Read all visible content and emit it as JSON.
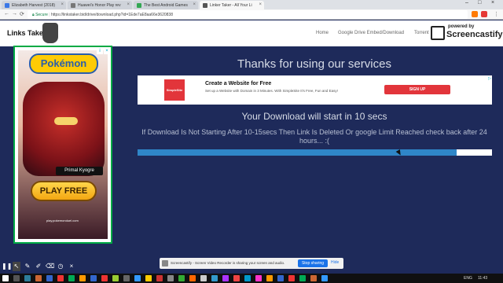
{
  "browser": {
    "tabs": [
      {
        "label": "Elizabeth Harvest (2018)",
        "color": "#3b78e7"
      },
      {
        "label": "Huawei's Honor Play rev",
        "color": "#777777"
      },
      {
        "label": "The Best Android Games",
        "color": "#34a853"
      },
      {
        "label": "Linker Taker - All Your Li",
        "color": "#555555"
      }
    ],
    "secure_label": "Secure",
    "url": "https://linkstaker.bid/drive/download.php?id=1Ede7aE8aa66e3620838"
  },
  "site": {
    "logo_text": "Links Taker",
    "nav": [
      "Home",
      "Google Drive Embed/Download",
      "Torrent"
    ],
    "castify_powered": "powered by",
    "castify_name": "Screencastify"
  },
  "ad": {
    "brand": "Pokémon",
    "subtitle": "Primal Kyogre",
    "cta": "PLAY FREE",
    "url": "play.pokemonduel.com"
  },
  "main": {
    "thanks": "Thanks for using our services",
    "banner": {
      "logo": "SimpleSite",
      "title": "Create a Website for Free",
      "subtitle": "Set up a Website with Domain in 3 Minutes. With SimpleSite It's Free, Fun and Easy!",
      "cta": "SIGN UP"
    },
    "countdown": "Your Download will start in 10 secs",
    "message": "If Download Is Not Starting After 10-15secs Then Link Is Deleted Or google Limit Reached check back after 24 hours... :(",
    "progress_fraction": 0.9
  },
  "sharebar": {
    "text": "Screencastify - Screen Video Recorder is sharing your screen and audio.",
    "stop": "Stop sharing",
    "hide": "Hide"
  },
  "taskbar": {
    "lang": "ENG",
    "time": "11:43"
  }
}
